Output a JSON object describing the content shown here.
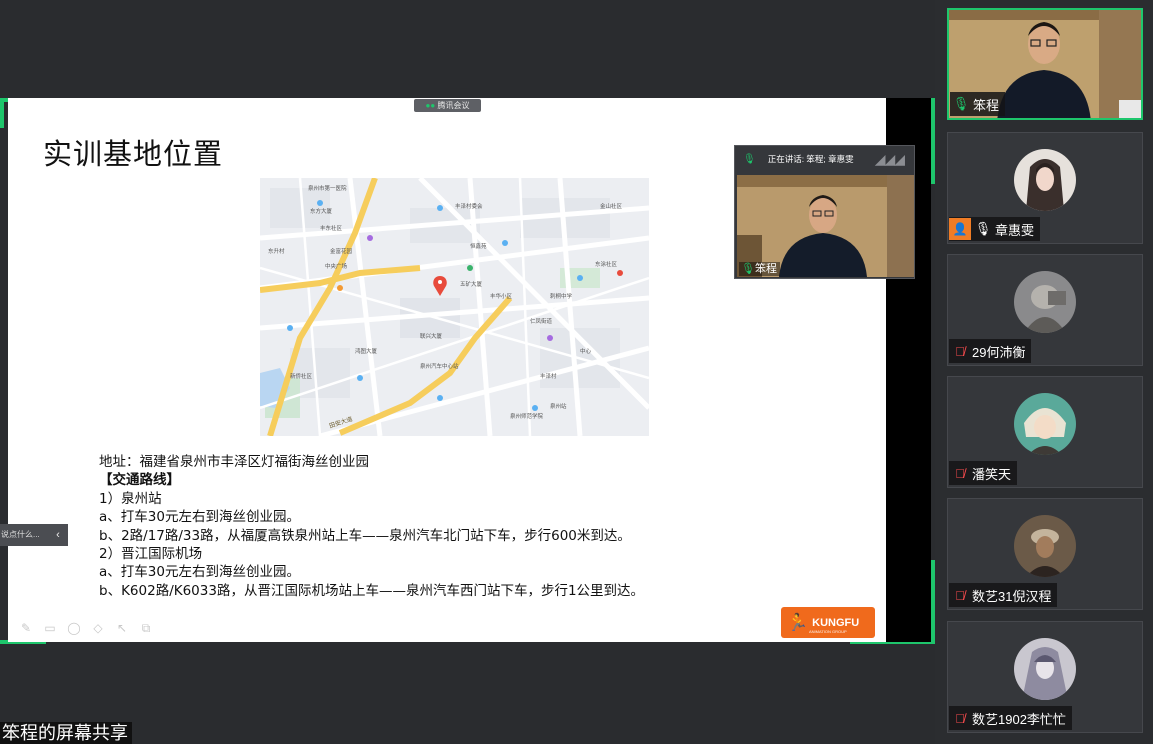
{
  "slide": {
    "title": "实训基地位置",
    "address": "地址：福建省泉州市丰泽区灯福街海丝创业园",
    "routes_heading": "【交通路线】",
    "lines": [
      "1）泉州站",
      "a、打车30元左右到海丝创业园。",
      "b、2路/17路/33路，从福厦高铁泉州站上车——泉州汽车北门站下车，步行600米到达。",
      "2）晋江国际机场",
      "a、打车30元左右到海丝创业园。",
      "b、K602路/K6033路，从晋江国际机场站上车——泉州汽车西门站下车，步行1公里到达。"
    ],
    "logo_text": "KUNGFU",
    "logo_sub": "ANIMATION GROUP"
  },
  "map": {
    "labels": [
      "泉州市第一医院",
      "东升村",
      "丰东社区",
      "金富花园",
      "丰泽村委会",
      "东方大厦",
      "鸿图大厦",
      "五矿大厦",
      "丰华小区",
      "恒鑫苑",
      "仁凤街道",
      "中央广场",
      "联兴大厦",
      "泉州汽车中心站",
      "刺桐中学",
      "东涂社区",
      "丰泽村",
      "泉州站",
      "泉州师范学院",
      "中心",
      "新侨社区",
      "金山社区"
    ],
    "road_label": "田安大道"
  },
  "tencent_tag": "腾讯会议",
  "speaker_window": {
    "header": "正在讲话: 笨程; 章惠雯",
    "name": "笨程"
  },
  "left_comment": "说点什么...",
  "share_label": "笨程的屏幕共享",
  "participants": [
    {
      "name": "笨程",
      "mic": "on"
    },
    {
      "name": "章惠雯",
      "mic": "on",
      "host": true
    },
    {
      "name": "29何沛衡",
      "mic": "muted"
    },
    {
      "name": "潘笑天",
      "mic": "muted"
    },
    {
      "name": "数艺31倪汉程",
      "mic": "muted"
    },
    {
      "name": "数艺1902李忙忙",
      "mic": "muted"
    }
  ],
  "colors": {
    "accent": "#1ec66c",
    "muted": "#ff4d4f",
    "logo": "#f06a1c",
    "host": "#f07c25"
  }
}
